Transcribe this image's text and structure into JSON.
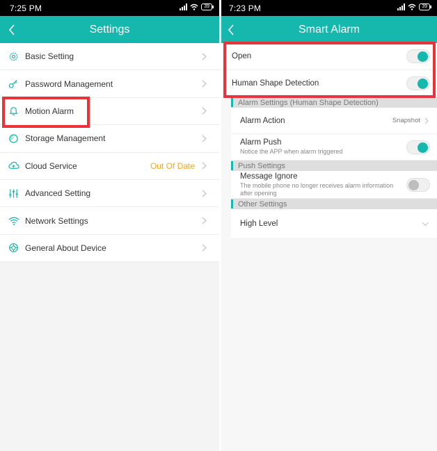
{
  "left": {
    "status_time": "7:25 PM",
    "battery": "39",
    "title": "Settings",
    "items": [
      {
        "label": "Basic Setting",
        "icon": "gear-icon"
      },
      {
        "label": "Password Management",
        "icon": "key-icon"
      },
      {
        "label": "Motion Alarm",
        "icon": "bell-icon"
      },
      {
        "label": "Storage Management",
        "icon": "storage-icon"
      },
      {
        "label": "Cloud Service",
        "icon": "cloud-icon",
        "value": "Out Of Date"
      },
      {
        "label": "Advanced Setting",
        "icon": "sliders-icon"
      },
      {
        "label": "Network Settings",
        "icon": "wifi-icon"
      },
      {
        "label": "General About Device",
        "icon": "info-icon"
      }
    ]
  },
  "right": {
    "status_time": "7:23 PM",
    "battery": "39",
    "title": "Smart Alarm",
    "open_label": "Open",
    "human_shape_label": "Human Shape Detection",
    "section_alarm": "Alarm Settings (Human Shape Detection)",
    "alarm_action_label": "Alarm Action",
    "alarm_action_value": "Snapshot",
    "alarm_push_label": "Alarm Push",
    "alarm_push_sub": "Notice the APP when alarm triggered",
    "section_push": "Push Settings",
    "message_ignore_label": "Message Ignore",
    "message_ignore_sub": "The mobile phone no longer receives alarm information after opening",
    "section_other": "Other Settings",
    "high_level_label": "High Level"
  },
  "colors": {
    "accent": "#16b8ae",
    "highlight": "#e8333a",
    "warning": "#f5a623"
  }
}
